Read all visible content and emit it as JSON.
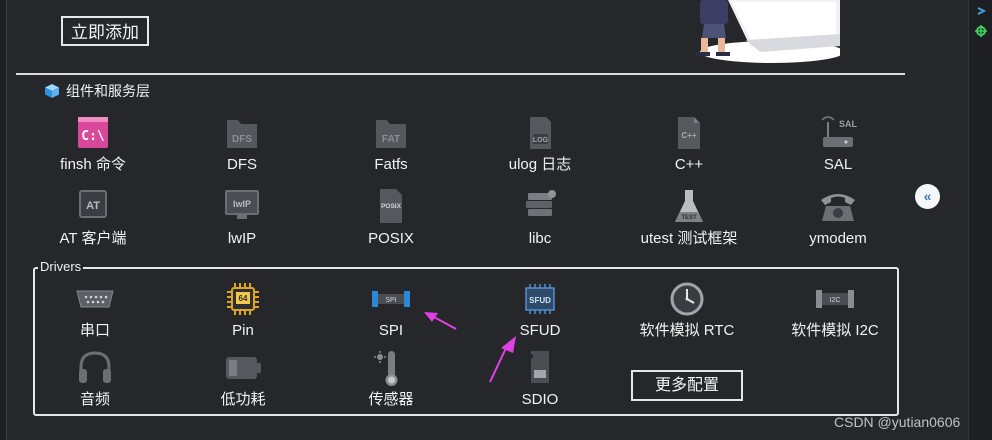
{
  "header": {
    "add_button_label": "立即添加"
  },
  "components_section": {
    "title": "组件和服务层",
    "items": [
      {
        "label": "finsh 命令",
        "icon": "terminal-icon"
      },
      {
        "label": "DFS",
        "icon": "dfs-folder-icon"
      },
      {
        "label": "Fatfs",
        "icon": "fat-folder-icon"
      },
      {
        "label": "ulog 日志",
        "icon": "log-file-icon"
      },
      {
        "label": "C++",
        "icon": "cpp-file-icon"
      },
      {
        "label": "SAL",
        "icon": "router-icon"
      },
      {
        "label": "AT 客户端",
        "icon": "at-chip-icon"
      },
      {
        "label": "lwIP",
        "icon": "monitor-icon"
      },
      {
        "label": "POSIX",
        "icon": "posix-file-icon"
      },
      {
        "label": "libc",
        "icon": "books-icon"
      },
      {
        "label": "utest 测试框架",
        "icon": "test-flask-icon"
      },
      {
        "label": "ymodem",
        "icon": "telephone-icon"
      }
    ]
  },
  "drivers_section": {
    "legend": "Drivers",
    "items": [
      {
        "label": "串口",
        "icon": "serial-port-icon"
      },
      {
        "label": "Pin",
        "icon": "cpu-chip-icon"
      },
      {
        "label": "SPI",
        "icon": "spi-bus-icon"
      },
      {
        "label": "SFUD",
        "icon": "sfud-chip-icon"
      },
      {
        "label": "软件模拟 RTC",
        "icon": "clock-icon"
      },
      {
        "label": "软件模拟 I2C",
        "icon": "i2c-bus-icon"
      },
      {
        "label": "音频",
        "icon": "headphones-icon"
      },
      {
        "label": "低功耗",
        "icon": "battery-icon"
      },
      {
        "label": "传感器",
        "icon": "thermometer-icon"
      },
      {
        "label": "SDIO",
        "icon": "sd-card-icon"
      }
    ],
    "more_button_label": "更多配置"
  },
  "sidebar_toggle": {
    "glyph": "«"
  },
  "watermark": "CSDN @yutian0606",
  "colors": {
    "background": "#25272b",
    "arrow": "#e23fe6",
    "accent_blue": "#3c78c8"
  }
}
